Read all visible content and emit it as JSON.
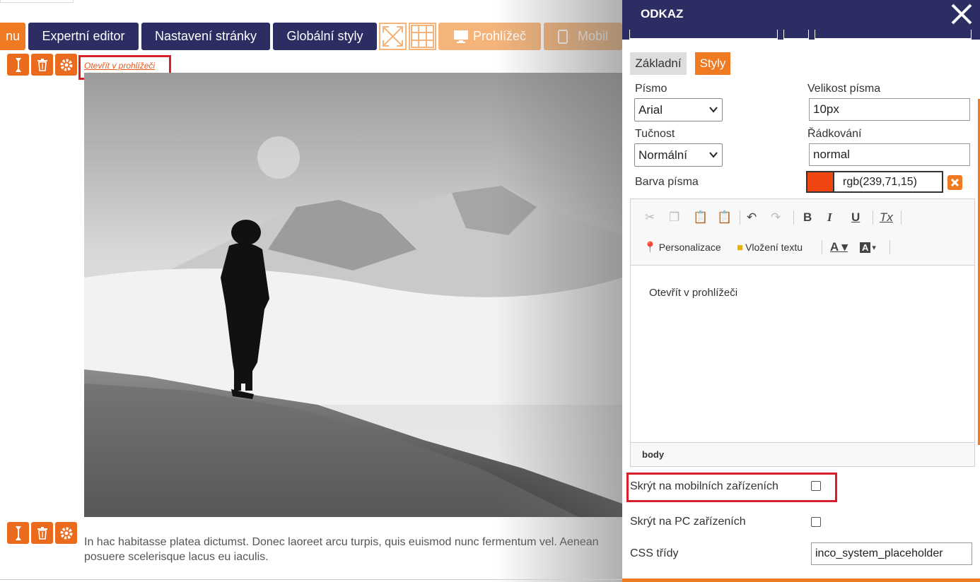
{
  "toolbar": {
    "menu_partial": "nu",
    "expert_editor": "Expertní editor",
    "page_settings": "Nastavení stránky",
    "global_styles": "Globální styly",
    "browser": "Prohlížeč",
    "mobile": "Mobil",
    "icons": [
      "fullscreen-icon",
      "grid-icon",
      "monitor-icon",
      "phone-icon"
    ]
  },
  "canvas": {
    "link_text": "Otevřít v prohlížeči",
    "paragraph_line1": "In hac habitasse platea dictumst. Donec laoreet arcu turpis, quis euismod nunc fermentum vel. Aenean",
    "paragraph_line2": "posuere scelerisque lacus eu iaculis.",
    "block_tool_icons": [
      "move-icon",
      "trash-icon",
      "gear-icon"
    ]
  },
  "panel": {
    "title": "ODKAZ",
    "tabs": [
      {
        "label": "Základní",
        "active": false
      },
      {
        "label": "Styly",
        "active": true
      }
    ],
    "font_label": "Písmo",
    "font_value": "Arial",
    "font_size_label": "Velikost písma",
    "font_size_value": "10px",
    "weight_label": "Tučnost",
    "weight_value": "Normální",
    "line_height_label": "Řádkování",
    "line_height_value": "normal",
    "color_label": "Barva písma",
    "color_value": "rgb(239,71,15)",
    "color_hex": "#ef470f",
    "editor": {
      "personalize": "Personalizace",
      "insert_text": "Vložení textu",
      "content": "Otevřít v prohlížeči",
      "status_path": "body",
      "icons": [
        "cut-icon",
        "copy-icon",
        "paste-icon",
        "paste-text-icon",
        "undo-icon",
        "redo-icon",
        "bold-icon",
        "italic-icon",
        "underline-icon",
        "clear-format-icon",
        "text-color-icon",
        "bg-color-icon"
      ]
    },
    "hide_mobile_label": "Skrýt na mobilních zařízeních",
    "hide_mobile_checked": false,
    "hide_pc_label": "Skrýt na PC zařízeních",
    "hide_pc_checked": false,
    "css_label": "CSS třídy",
    "css_value": "inco_system_placeholder"
  },
  "colors": {
    "navy": "#2b2d63",
    "orange": "#f07a22",
    "highlight": "#d81e2a"
  }
}
